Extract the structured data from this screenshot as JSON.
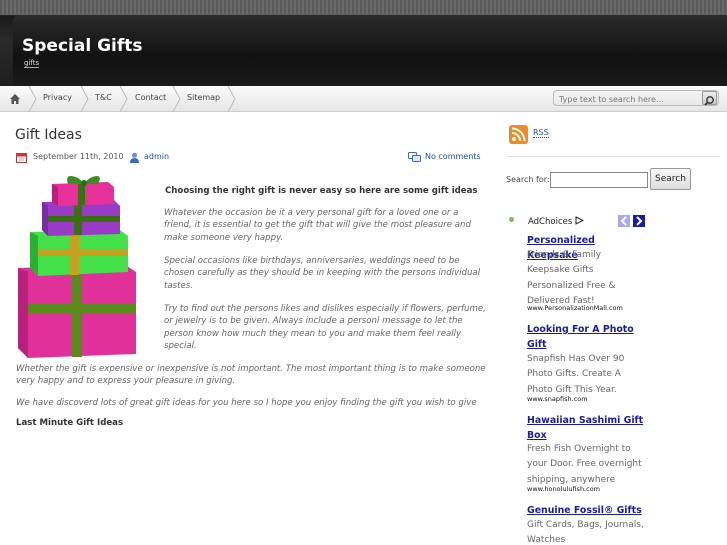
{
  "site": {
    "title": "Special Gifts",
    "description": "gifts"
  },
  "nav": {
    "items": [
      "Privacy",
      "T&C",
      "Contact",
      "Sitemap"
    ],
    "search_placeholder": "Type text to search here..."
  },
  "post": {
    "title": "Gift Ideas",
    "date": "September 11th, 2010",
    "author": "admin",
    "comments": "No comments",
    "intro_heading": "Choosing the right gift is never easy so here are some gift ideas",
    "paragraphs": [
      "Whatever the occasion be it a very personal gift for a loved one or a friend, it is essential to get the gift that will give the most  pleasure and make someone very happy.",
      "Special occasions like birthdays, anniversaries, weddings need to be chosen carefully as they should be in keeping with the persons individual tastes.",
      "Try to find out the persons likes and dislikes especially if flowers, perfume, or jewelry is to be given. Always include a personl message to let the person know how much they mean to you and make them feel really special.",
      "Whether the gift is expensive or inexpensive is not important. The most important thing is to make someone very happy and to express your pleasure in giving.",
      "We have discoverd lots of great gift ideas for you here so I hope you enjoy finding the gift you wish to give"
    ],
    "subheading": "Last Minute Gift Ideas"
  },
  "sidebar": {
    "rss": "RSS",
    "search_label": "Search for:",
    "search_button": "Search",
    "adchoices": "AdChoices",
    "ads": [
      {
        "title": "Personalized Keepsake",
        "body": "Friends & Family Keepsake Gifts Personalized Free & Delivered Fast!",
        "url": "www.PersonalizationMall.com"
      },
      {
        "title": "Looking For A Photo Gift",
        "body": "Snapfish Has Over 90 Photo Gifts. Create A Photo Gift This Year.",
        "url": "www.snapfish.com"
      },
      {
        "title": "Hawaiian Sashimi Gift Box",
        "body": "Fresh Fish Overnight to your Door. Free overnight shipping, anywhere",
        "url": "www.honolulufish.com"
      },
      {
        "title": "Genuine Fossil® Gifts",
        "body": "Gift Cards, Bags, Journals, Watches",
        "url": ""
      }
    ]
  },
  "colors": {
    "link": "#1c4e9e",
    "ad_link": "#1a1aa6",
    "header_bg": "#1a1a1a"
  }
}
